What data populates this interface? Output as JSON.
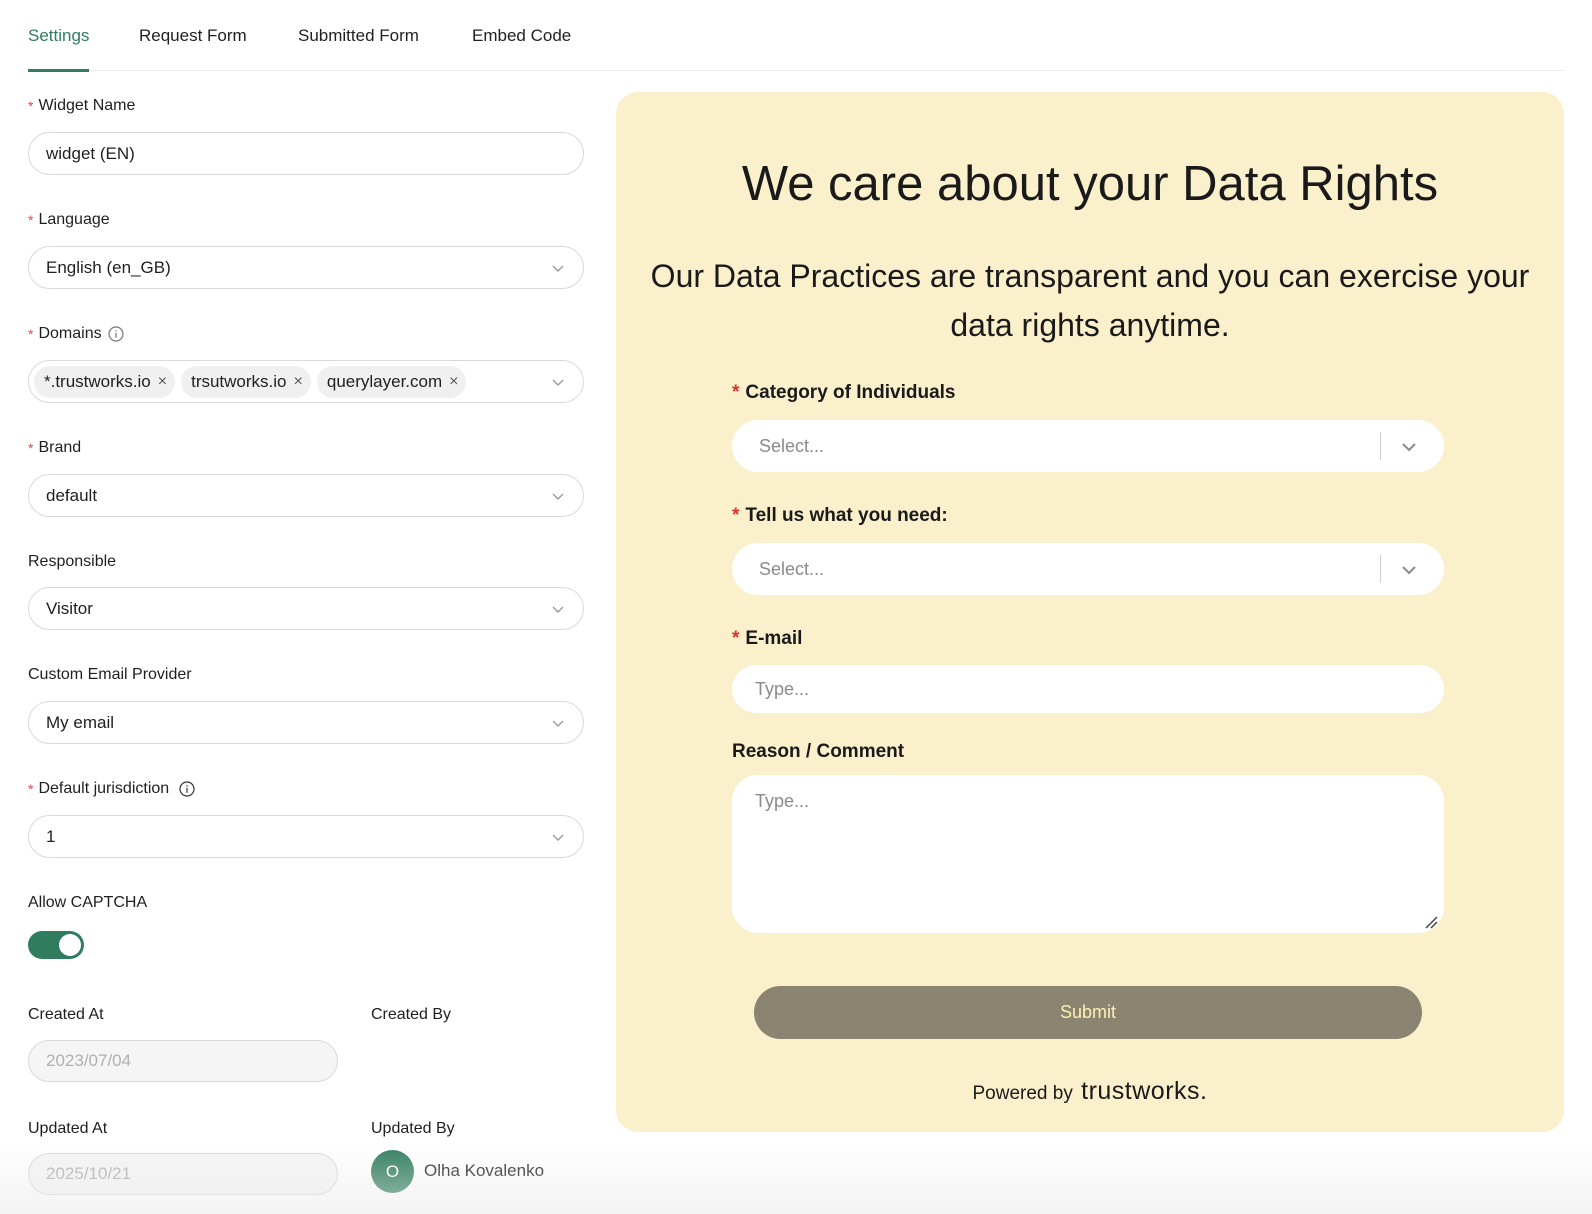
{
  "tabs": [
    {
      "label": "Settings",
      "active": true
    },
    {
      "label": "Request Form",
      "active": false
    },
    {
      "label": "Submitted Form",
      "active": false
    },
    {
      "label": "Embed Code",
      "active": false
    }
  ],
  "form": {
    "widget_name": {
      "label": "Widget Name",
      "value": "widget (EN)"
    },
    "language": {
      "label": "Language",
      "value": "English (en_GB)"
    },
    "domains": {
      "label": "Domains",
      "tags": [
        "*.trustworks.io",
        "trsutworks.io",
        "querylayer.com"
      ]
    },
    "brand": {
      "label": "Brand",
      "value": "default"
    },
    "responsible": {
      "label": "Responsible",
      "value": "Visitor"
    },
    "custom_email_provider": {
      "label": "Custom Email Provider",
      "value": "My email"
    },
    "default_jurisdiction": {
      "label": "Default jurisdiction",
      "value": "1"
    },
    "allow_captcha": {
      "label": "Allow CAPTCHA",
      "enabled": true
    },
    "created_at": {
      "label": "Created At",
      "value": "2023/07/04"
    },
    "created_by": {
      "label": "Created By"
    },
    "updated_at": {
      "label": "Updated At",
      "value": "2025/10/21"
    },
    "updated_by": {
      "label": "Updated By",
      "initial": "O",
      "name": "Olha Kovalenko"
    }
  },
  "preview": {
    "title": "We care about your Data Rights",
    "subtitle": "Our Data Practices are transparent and you can exercise your data rights anytime.",
    "category": {
      "label": "Category of Individuals",
      "placeholder": "Select..."
    },
    "need": {
      "label": "Tell us what you need:",
      "placeholder": "Select..."
    },
    "email": {
      "label": "E-mail",
      "placeholder": "Type..."
    },
    "reason": {
      "label": "Reason / Comment",
      "placeholder": "Type..."
    },
    "submit_label": "Submit",
    "powered_prefix": "Powered by",
    "powered_brand": "trustworks."
  },
  "colors": {
    "accent": "#2f7d5e",
    "preview_bg": "#faf0cb",
    "submit_bg": "#8b8470",
    "submit_text": "#fdf1b5",
    "required": "#e5484d"
  },
  "icons": [
    "info-icon",
    "chevron-down-icon",
    "close-icon",
    "resize-handle-icon"
  ]
}
